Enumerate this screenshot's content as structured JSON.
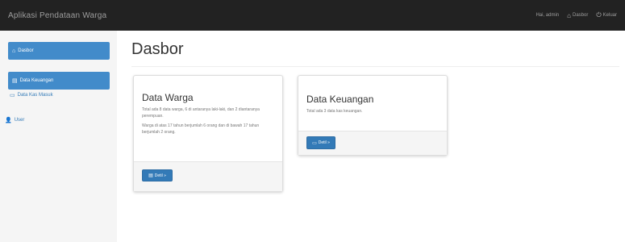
{
  "app": {
    "title": "Aplikasi Pendataan Warga"
  },
  "navbar": {
    "greeting": "Hai, admin",
    "dashboard_label": "Dasbor",
    "logout_label": "Keluar"
  },
  "sidebar": {
    "dashboard_label": "Dasbor",
    "finance_label": "Data Keuangan",
    "finance_sub_label": "Data Kas Masuk",
    "user_label": "User"
  },
  "main": {
    "title": "Dasbor",
    "cards": [
      {
        "title": "Data Warga",
        "text1": "Total ada 8 data warga, 6 di antaranya laki-laki, dan 2 diantaranya perempuan.",
        "text2": "Warga di atas 17 tahun berjumlah 6 orang dan di bawah 17 tahun berjumlah 2 orang.",
        "button_label": "Detil »"
      },
      {
        "title": "Data Keuangan",
        "text1": "Total ada 3 data kas keuangan.",
        "button_label": "Detil »"
      }
    ]
  },
  "colors": {
    "primary": "#337ab7",
    "navbar": "#222222",
    "active": "#428bca"
  },
  "icons": {
    "home": "home-icon",
    "list": "list-icon",
    "book": "book-icon",
    "user": "user-icon",
    "logout": "power-icon"
  }
}
